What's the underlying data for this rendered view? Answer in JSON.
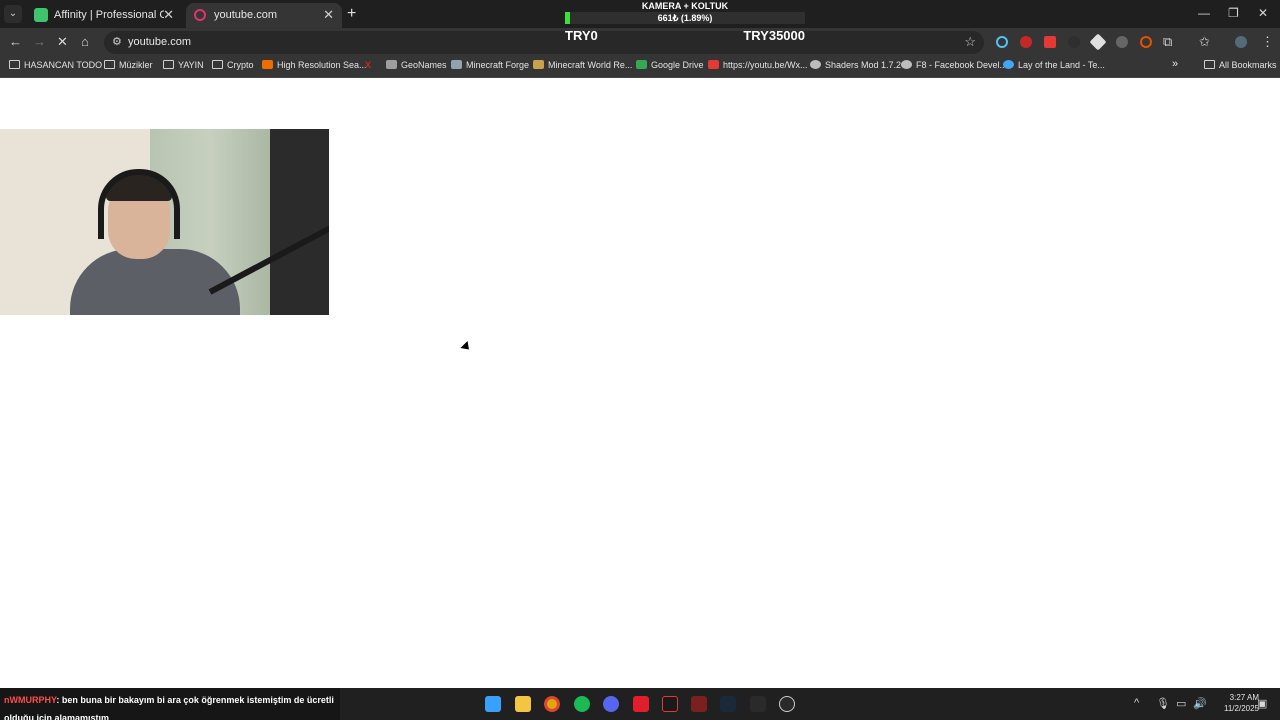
{
  "browser": {
    "tabs": [
      {
        "title": "Affinity | Professional Creative S",
        "active": false
      },
      {
        "title": "youtube.com",
        "active": true
      }
    ],
    "omnibox": {
      "url": "youtube.com"
    }
  },
  "overlay": {
    "title": "KAMERA + KOLTUK",
    "progress_text": "661₺ (1.89%)",
    "progress_fraction": 0.0189,
    "min_label": "TRY0",
    "max_label": "TRY35000",
    "bar_color": "#3be03b"
  },
  "bookmarks": [
    {
      "label": "HASANCAN TODO",
      "icon": "folder-icon"
    },
    {
      "label": "Müzikler",
      "icon": "folder-icon"
    },
    {
      "label": "YAYIN",
      "icon": "folder-icon"
    },
    {
      "label": "Crypto",
      "icon": "folder-icon"
    },
    {
      "label": "High Resolution Sea...",
      "icon": "blogger-icon"
    },
    {
      "label": "GeoNames",
      "icon": "geonames-icon"
    },
    {
      "label": "Minecraft Forge",
      "icon": "forge-icon"
    },
    {
      "label": "Minecraft World Re...",
      "icon": "minecraft-icon"
    },
    {
      "label": "Google Drive",
      "icon": "drive-icon"
    },
    {
      "label": "https://youtu.be/Wx...",
      "icon": "youtube-icon"
    },
    {
      "label": "Shaders Mod 1.7.2",
      "icon": "globe-icon"
    },
    {
      "label": "F8 - Facebook Devel...",
      "icon": "globe-icon"
    },
    {
      "label": "Lay of the Land - Te...",
      "icon": "globe-icon"
    },
    {
      "label": "All Bookmarks",
      "icon": "folder-icon"
    }
  ],
  "chat": {
    "user": "nWMURPHY",
    "message": ": ben buna bir bakayım bi ara çok öğrenmek istemiştim de ücretli olduğu için alamamıştım"
  },
  "clock": {
    "time": "3:27 AM",
    "date": "11/2/2025"
  }
}
